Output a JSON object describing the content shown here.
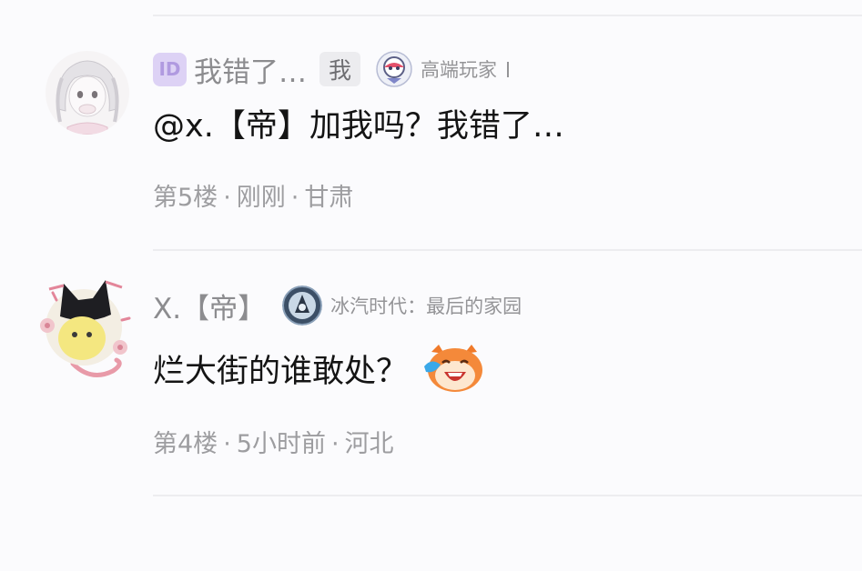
{
  "comments": [
    {
      "user": {
        "id_badge": "ID",
        "name": "我错了…",
        "self_tag": "我",
        "forum_icon": "forum-badge-icon",
        "forum_name": "高端玩家"
      },
      "text": "@x.【帝】加我吗？我错了…",
      "meta": {
        "floor": "第5楼",
        "time": "刚刚",
        "location": "甘肃",
        "separator": "·"
      }
    },
    {
      "user": {
        "name": "X.【帝】",
        "forum_icon": "game-badge-icon",
        "forum_name": "冰汽时代：最后的家园"
      },
      "text": "烂大街的谁敢处？",
      "emoji": "laughing-emoji",
      "meta": {
        "floor": "第4楼",
        "time": "5小时前",
        "location": "河北",
        "separator": "·"
      }
    }
  ],
  "colors": {
    "primary_text": "#141414",
    "secondary_text": "#8c8c8f",
    "meta_text": "#9d9da0",
    "id_badge_bg": "#ddd2f5",
    "divider": "#ededf0"
  }
}
